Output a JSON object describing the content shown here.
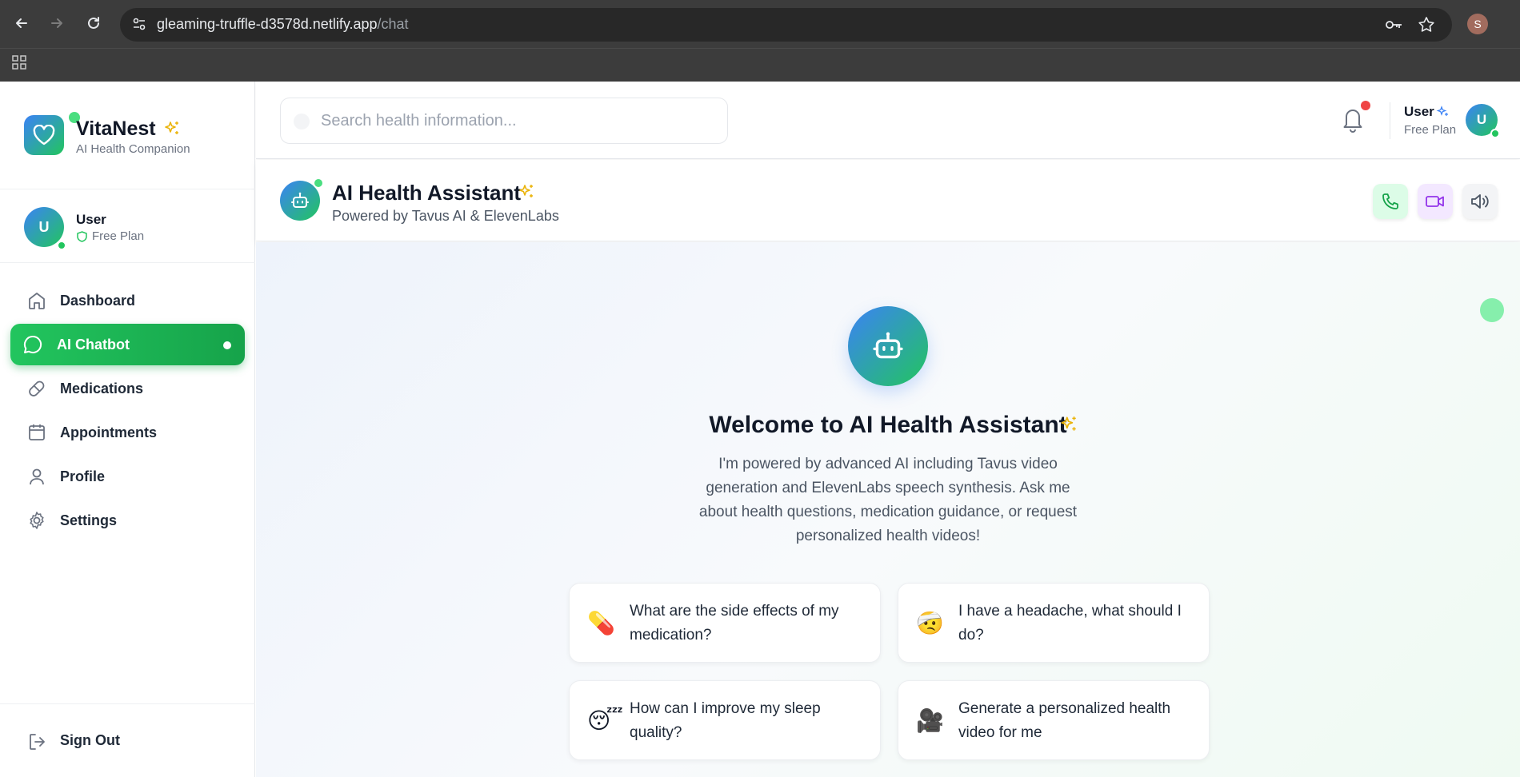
{
  "browser": {
    "url_host": "gleaming-truffle-d3578d.netlify.app",
    "url_path": "/chat",
    "profile_initial": "S"
  },
  "brand": {
    "name": "VitaNest",
    "subtitle": "AI Health Companion"
  },
  "sidebar_user": {
    "initial": "U",
    "name": "User",
    "plan": "Free Plan"
  },
  "nav": {
    "items": [
      {
        "label": "Dashboard",
        "icon": "home-icon"
      },
      {
        "label": "AI Chatbot",
        "icon": "chat-bubble-icon",
        "active": true
      },
      {
        "label": "Medications",
        "icon": "pill-icon"
      },
      {
        "label": "Appointments",
        "icon": "calendar-icon"
      },
      {
        "label": "Profile",
        "icon": "user-icon"
      },
      {
        "label": "Settings",
        "icon": "gear-icon"
      }
    ],
    "signout_label": "Sign Out"
  },
  "header": {
    "search_placeholder": "Search health information...",
    "user_name": "User",
    "user_plan": "Free Plan",
    "user_initial": "U"
  },
  "chat": {
    "title": "AI Health Assistant",
    "subtitle": "Powered by Tavus AI & ElevenLabs",
    "welcome_title": "Welcome to AI Health Assistant",
    "intro": "I'm powered by advanced AI including Tavus video generation and ElevenLabs speech synthesis. Ask me about health questions, medication guidance, or request personalized health videos!",
    "prompts": [
      {
        "emoji": "💊",
        "text": "What are the side effects of my medication?"
      },
      {
        "emoji": "🤕",
        "text": "I have a headache, what should I do?"
      },
      {
        "emoji": "😴",
        "text": "How can I improve my sleep quality?"
      },
      {
        "emoji": "🎥",
        "text": "Generate a personalized health video for me"
      }
    ]
  },
  "colors": {
    "accent_green": "#22c55e",
    "accent_blue": "#3b82f6",
    "alert_red": "#ef4444"
  }
}
